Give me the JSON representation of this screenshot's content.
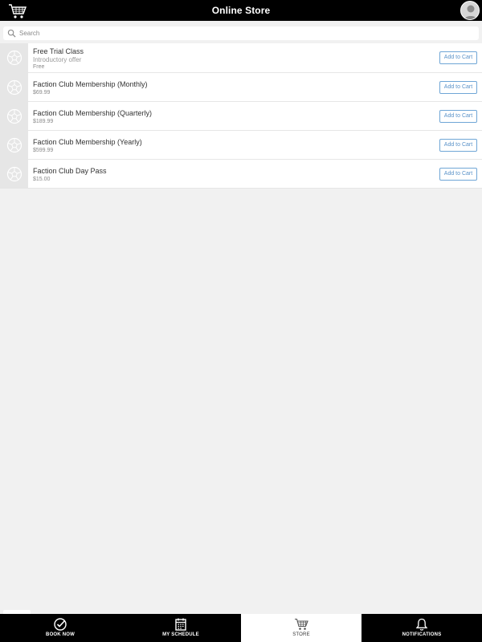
{
  "header": {
    "title": "Online Store",
    "cart_icon": "cart-icon",
    "avatar_icon": "avatar-icon"
  },
  "search": {
    "placeholder": "Search",
    "icon": "search-icon"
  },
  "products": [
    {
      "name": "Free Trial Class",
      "subtitle": "Introductory offer",
      "price": "Free",
      "button": "Add to Cart"
    },
    {
      "name": "Faction Club Membership (Monthly)",
      "subtitle": "",
      "price": "$69.99",
      "button": "Add to Cart"
    },
    {
      "name": "Faction Club Membership (Quarterly)",
      "subtitle": "",
      "price": "$189.99",
      "button": "Add to Cart"
    },
    {
      "name": "Faction Club Membership (Yearly)",
      "subtitle": "",
      "price": "$599.99",
      "button": "Add to Cart"
    },
    {
      "name": "Faction Club Day Pass",
      "subtitle": "",
      "price": "$15.00",
      "button": "Add to Cart"
    }
  ],
  "tabs": [
    {
      "label": "BOOK NOW",
      "icon": "check-circle-icon",
      "active": false
    },
    {
      "label": "MY SCHEDULE",
      "icon": "calendar-icon",
      "active": false
    },
    {
      "label": "STORE",
      "icon": "cart-icon",
      "active": true
    },
    {
      "label": "NOTIFICATIONS",
      "icon": "bell-icon",
      "active": false
    }
  ],
  "colors": {
    "header_bg": "#000000",
    "accent": "#5b93c9",
    "background": "#f1f1f1"
  }
}
